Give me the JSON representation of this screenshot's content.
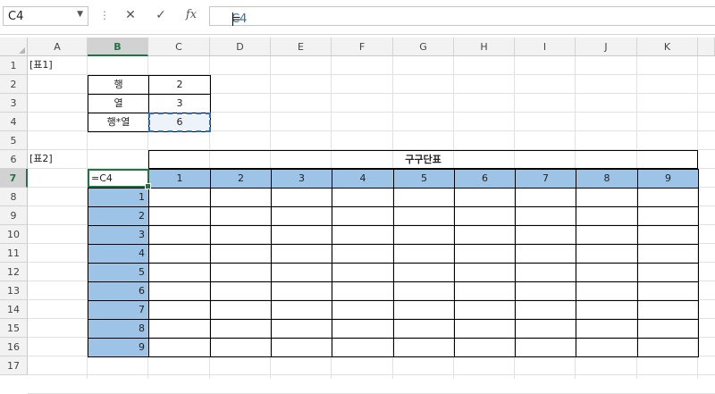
{
  "formula_bar": {
    "name_box": "C4",
    "formula_prefix": "=",
    "formula_ref": "C4",
    "cancel_icon": "close-icon",
    "enter_icon": "check-icon",
    "function_icon": "fx-icon",
    "function_label": "fx"
  },
  "columns": [
    "A",
    "B",
    "C",
    "D",
    "E",
    "F",
    "G",
    "H",
    "I",
    "J",
    "K"
  ],
  "rows": [
    "1",
    "2",
    "3",
    "4",
    "5",
    "6",
    "7",
    "8",
    "9",
    "10",
    "11",
    "12",
    "13",
    "14",
    "15",
    "16",
    "17"
  ],
  "table1": {
    "label": "[표1]",
    "rows": [
      {
        "label": "행",
        "value": "2"
      },
      {
        "label": "열",
        "value": "3"
      },
      {
        "label": "행*열",
        "value": "6"
      }
    ]
  },
  "table2": {
    "label": "[표2]",
    "title": "구구단표",
    "active_cell_text": "=C4",
    "col_headers": [
      "1",
      "2",
      "3",
      "4",
      "5",
      "6",
      "7",
      "8",
      "9"
    ],
    "row_headers": [
      "1",
      "2",
      "3",
      "4",
      "5",
      "6",
      "7",
      "8",
      "9"
    ]
  },
  "colors": {
    "header_fill": "#9dc3e6",
    "selection_green": "#217346",
    "copy_border": "#2f6fba"
  }
}
